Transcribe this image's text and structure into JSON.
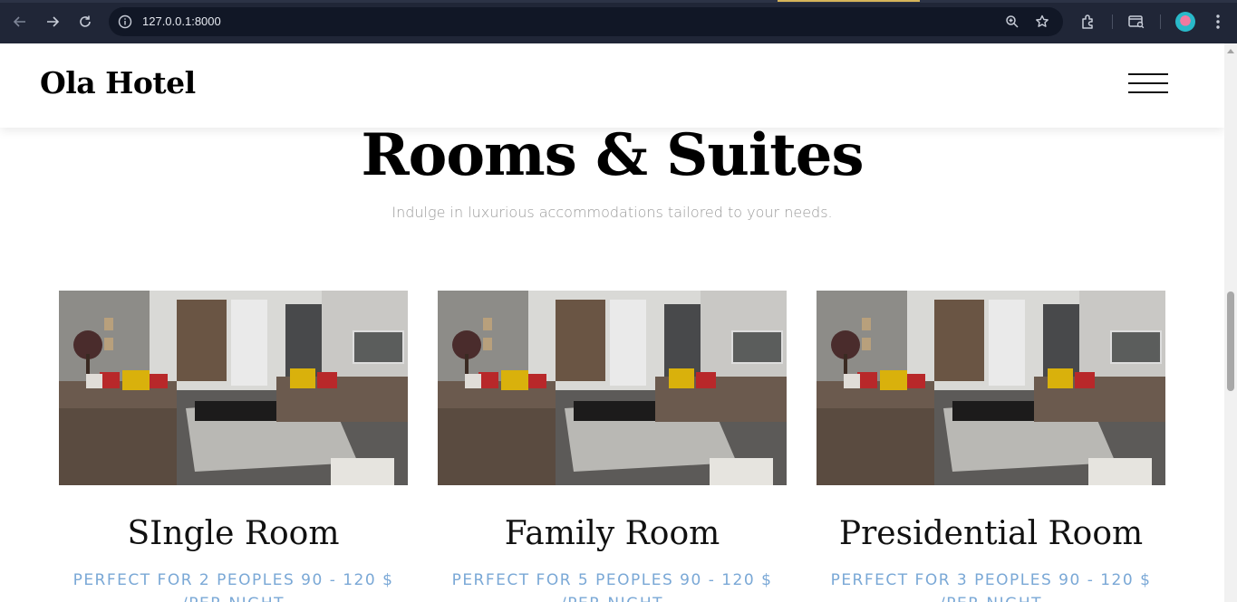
{
  "browser": {
    "url": "127.0.0.1:8000",
    "icons": [
      "back-icon",
      "forward-icon",
      "reload-icon",
      "site-info-icon",
      "zoom-icon",
      "bookmark-star-icon",
      "extensions-icon",
      "tab-search-icon",
      "profile-avatar",
      "menu-kebab-icon"
    ]
  },
  "header": {
    "brand": "Ola Hotel",
    "menu_icon": "hamburger-icon"
  },
  "section": {
    "title": "Rooms & Suites",
    "subtitle": "Indulge in luxurious accommodations tailored to your needs."
  },
  "rooms": [
    {
      "name": "SIngle Room",
      "meta": "PERFECT FOR 2 PEOPLES 90 - 120 $",
      "meta2": "/PER NIGHT"
    },
    {
      "name": "Family Room",
      "meta": "PERFECT FOR 5 PEOPLES 90 - 120 $",
      "meta2": "/PER NIGHT"
    },
    {
      "name": "Presidential Room",
      "meta": "PERFECT FOR 3 PEOPLES 90 - 120 $",
      "meta2": "/PER NIGHT"
    }
  ],
  "colors": {
    "chrome_bg": "#202637",
    "omnibox_bg": "#111726",
    "meta_text": "#7aa8d6",
    "subtitle_text": "#9a9a9a"
  }
}
